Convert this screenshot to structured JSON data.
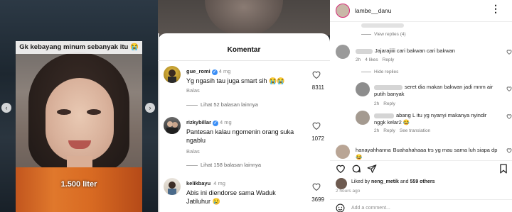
{
  "video": {
    "caption_top": "Gk kebayang minum sebanyak itu 😭",
    "caption_bottom": "1.500 liter"
  },
  "comments_sheet": {
    "title": "Komentar",
    "reply_label": "Balas",
    "comments": [
      {
        "username": "gue_romi",
        "verified": true,
        "time": "4 mg",
        "text": "Yg ngasih tau juga smart sih 😭😭",
        "likes": "8311",
        "more_replies": "Lihat 52 balasan lainnya"
      },
      {
        "username": "rizkybillar",
        "verified": true,
        "time": "4 mg",
        "text": "Pantesan kalau ngomenin orang suka ngablu",
        "likes": "1072",
        "more_replies": "Lihat 158 balasan lainnya"
      },
      {
        "username": "kelikbayu",
        "verified": false,
        "time": "4 mg",
        "text": "Abis ini diendorse sama Waduk Jatiluhur 😢",
        "likes": "3699",
        "more_replies": ""
      }
    ]
  },
  "instagram": {
    "username": "lambe__danu",
    "more_icon": "⋮",
    "view_replies": "View replies (4)",
    "hide_replies": "Hide replies",
    "comments": [
      {
        "text": "Jajarajiiii cari bakwan cari bakwan",
        "time": "2h",
        "likes": "4 likes",
        "reply": "Reply"
      },
      {
        "text": "seret dia makan bakwan jadi mnm air putih banyak",
        "time": "2h",
        "likes": "",
        "reply": "Reply"
      },
      {
        "text": "abang L itu yg nyanyi makanya nyindir nggk kelar2 😂",
        "time": "2h",
        "likes": "",
        "reply": "Reply",
        "translate": "See translation"
      },
      {
        "username": "hanayahhanna",
        "text": "Buahahahaaa trs yg mau sama luh siapa dp 😂",
        "time": "",
        "likes": "",
        "reply": ""
      }
    ],
    "liked_by": "Liked by",
    "liked_user": "neng_metik",
    "liked_and": "and",
    "liked_others": "559 others",
    "time_ago": "2 hours ago",
    "add_comment_placeholder": "Add a comment...",
    "colors": {
      "verified": "#3a8ef6",
      "story_ring": "#d62976"
    }
  }
}
